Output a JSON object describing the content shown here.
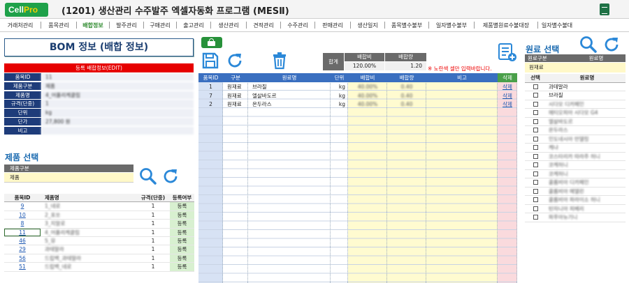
{
  "app": {
    "logo_prefix": "Cell",
    "logo_suffix": "Pro",
    "title": "(1201) 생산관리 수주발주 엑셀자동화 프로그램 (MESⅡ)"
  },
  "menu": [
    "거래처관리",
    "품목관리",
    "배합정보",
    "발주관리",
    "구매관리",
    "출고관리",
    "생산관리",
    "견적관리",
    "수주관리",
    "판매관리",
    "생산일지",
    "품목별수불부",
    "일자별수불부",
    "제품별원료수불대장",
    "일자별수불대"
  ],
  "menu_active": "배합정보",
  "bom": {
    "title": "BOM 정보 (배합 정보)",
    "edit_label": "등록 배합정보(EDIT)",
    "fields": [
      {
        "label": "품목ID",
        "value": "11"
      },
      {
        "label": "제품구분",
        "value": "제품"
      },
      {
        "label": "제품명",
        "value": "4_어플리케클림"
      },
      {
        "label": "규격(단중)",
        "value": "1"
      },
      {
        "label": "단위",
        "value": "kg"
      },
      {
        "label": "단가",
        "value": "27,800 원"
      },
      {
        "label": "비고",
        "value": ""
      }
    ]
  },
  "product_select": {
    "title": "제품 선택",
    "category_label": "제품구분",
    "category_value": "제품",
    "headers": [
      "품목ID",
      "제품명",
      "규격(단중)",
      "등록여부"
    ],
    "rows": [
      {
        "id": "9",
        "name": "1_네로",
        "spec": "1",
        "status": "등록"
      },
      {
        "id": "10",
        "name": "2_포쏘",
        "spec": "1",
        "status": "등록"
      },
      {
        "id": "8",
        "name": "3_지알로",
        "spec": "1",
        "status": "등록"
      },
      {
        "id": "11",
        "name": "4_어플리케클림",
        "spec": "1",
        "status": "등록"
      },
      {
        "id": "46",
        "name": "5_뮤",
        "spec": "1",
        "status": "등록"
      },
      {
        "id": "29",
        "name": "과테말라",
        "spec": "1",
        "status": "등록"
      },
      {
        "id": "56",
        "name": "드립백_과테말라",
        "spec": "1",
        "status": "등록"
      },
      {
        "id": "51",
        "name": "드립백_네로",
        "spec": "1",
        "status": "등록"
      }
    ]
  },
  "summary": {
    "label": "합계",
    "ratio_label": "배합비",
    "amount_label": "배합량",
    "ratio_value": "120.00%",
    "amount_value": "1.20"
  },
  "warning": "※ 노란색 셀만 입력바랍니다.",
  "mix_table": {
    "headers": [
      "품목ID",
      "구분",
      "원료명",
      "단위",
      "배합비",
      "배합량",
      "비고",
      "삭제"
    ],
    "rows": [
      {
        "id": "1",
        "type": "원재료",
        "name": "브라질",
        "unit": "kg",
        "ratio": "40.00%",
        "amount": "0.40",
        "note": "",
        "del": "삭제"
      },
      {
        "id": "7",
        "type": "원재료",
        "name": "엘살바도르",
        "unit": "kg",
        "ratio": "40.00%",
        "amount": "0.40",
        "note": "",
        "del": "삭제"
      },
      {
        "id": "2",
        "type": "원재료",
        "name": "온두라스",
        "unit": "kg",
        "ratio": "40.00%",
        "amount": "0.40",
        "note": "",
        "del": "삭제"
      }
    ]
  },
  "material_select": {
    "title": "원료 선택",
    "headers": [
      "원료구분",
      "원료명"
    ],
    "category_value": "원재료",
    "list_headers": [
      "선택",
      "원료명"
    ],
    "items": [
      "과테말라",
      "브라질",
      "시다모 디카페인",
      "에티오피아 시다모 G4",
      "엘살바도르",
      "온두라스",
      "인도네시아 만델링",
      "케냐",
      "코스타리카 따라주 허니",
      "코케허니",
      "코케허니",
      "콜롬비아 디카페인",
      "콜롬비아 메델린",
      "콜롬비아 파라이소 허니",
      "탄자니아 피베리",
      "파푸아뉴기니"
    ]
  },
  "colors": {
    "navy": "#1e3c7a",
    "header_blue": "#3a6fc0",
    "green": "#27913a",
    "red": "#e60000",
    "yellow": "#fff8c8"
  }
}
